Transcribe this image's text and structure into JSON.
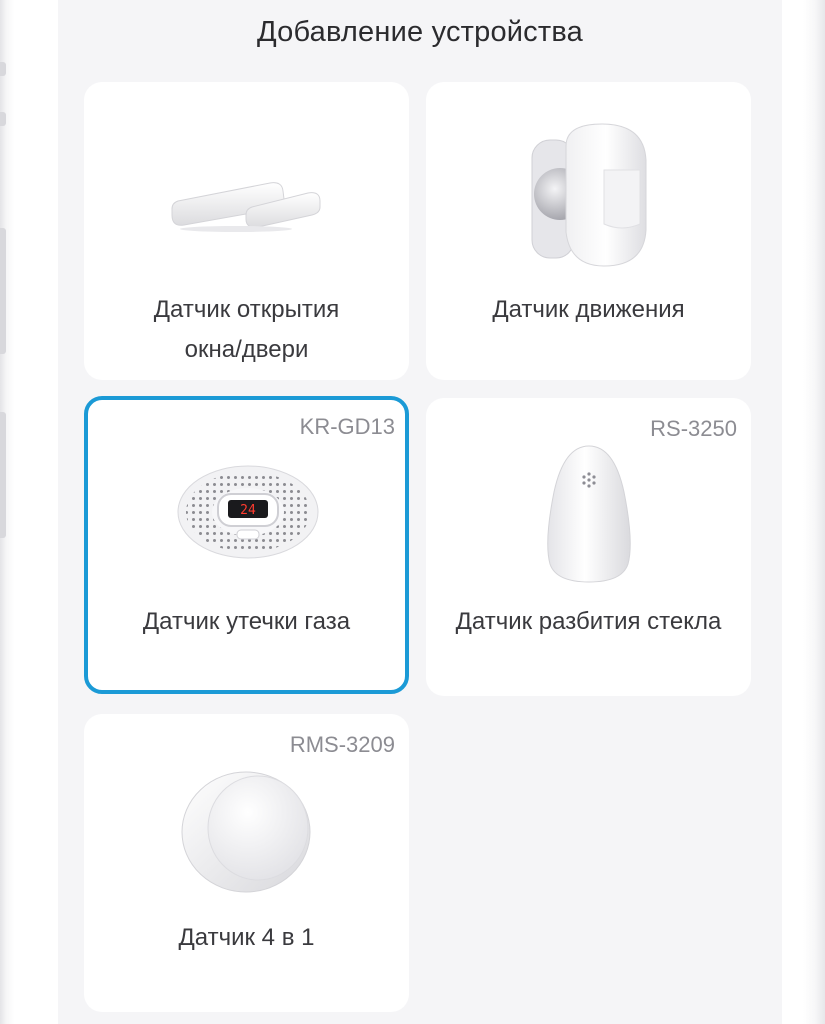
{
  "header": {
    "title": "Добавление устройства"
  },
  "devices": [
    {
      "label_line1": "Датчик открытия",
      "label_line2": "окна/двери",
      "model": "",
      "icon": "door-window-sensor-icon"
    },
    {
      "label_line1": "Датчик движения",
      "model": "",
      "icon": "motion-sensor-icon"
    },
    {
      "label_line1": "Датчик утечки газа",
      "model": "KR-GD13",
      "icon": "gas-leak-sensor-icon",
      "selected": true
    },
    {
      "label_line1": "Датчик разбития стекла",
      "model": "RS-3250",
      "icon": "glass-break-sensor-icon"
    },
    {
      "label_line1": "Датчик 4 в 1",
      "model": "RMS-3209",
      "icon": "multisensor-icon"
    }
  ],
  "gas_display": "24",
  "colors": {
    "accent": "#1b9ad6",
    "card": "#ffffff",
    "background": "#f5f5f7",
    "display_red": "#ff3b2f"
  }
}
